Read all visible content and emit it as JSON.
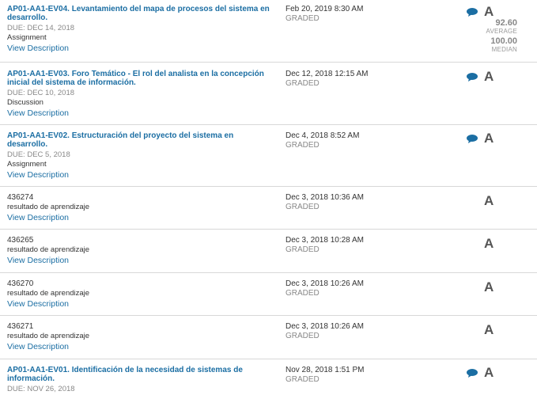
{
  "rows": [
    {
      "title": "AP01-AA1-EV04. Levantamiento del mapa de procesos del sistema en desarrollo.",
      "due": "DUE: DEC 14, 2018",
      "type": "Assignment",
      "view": "View Description",
      "date": "Feb 20, 2019 8:30 AM",
      "status": "GRADED",
      "grade": "A",
      "has_comment": true,
      "average_value": "92.60",
      "average_label": "AVERAGE",
      "median_value": "100.00",
      "median_label": "MEDIAN"
    },
    {
      "title": "AP01-AA1-EV03. Foro Temático - El rol del analista en la concepción inicial del sistema de información.",
      "due": "DUE: DEC 10, 2018",
      "type": "Discussion",
      "view": "View Description",
      "date": "Dec 12, 2018 12:15 AM",
      "status": "GRADED",
      "grade": "A",
      "has_comment": true
    },
    {
      "title": "AP01-AA1-EV02. Estructuración del proyecto del sistema en desarrollo.",
      "due": "DUE: DEC 5, 2018",
      "type": "Assignment",
      "view": "View Description",
      "date": "Dec 4, 2018 8:52 AM",
      "status": "GRADED",
      "grade": "A",
      "has_comment": true
    },
    {
      "id": "436274",
      "type": "resultado de aprendizaje",
      "view": "View Description",
      "date": "Dec 3, 2018 10:36 AM",
      "status": "GRADED",
      "grade": "A",
      "has_comment": false
    },
    {
      "id": "436265",
      "type": "resultado de aprendizaje",
      "view": "View Description",
      "date": "Dec 3, 2018 10:28 AM",
      "status": "GRADED",
      "grade": "A",
      "has_comment": false
    },
    {
      "id": "436270",
      "type": "resultado de aprendizaje",
      "view": "View Description",
      "date": "Dec 3, 2018 10:26 AM",
      "status": "GRADED",
      "grade": "A",
      "has_comment": false
    },
    {
      "id": "436271",
      "type": "resultado de aprendizaje",
      "view": "View Description",
      "date": "Dec 3, 2018 10:26 AM",
      "status": "GRADED",
      "grade": "A",
      "has_comment": false
    },
    {
      "title": "AP01-AA1-EV01. Identificación de la necesidad de sistemas de información.",
      "due": "DUE: NOV 26, 2018",
      "date": "Nov 28, 2018 1:51 PM",
      "status": "GRADED",
      "grade": "A",
      "has_comment": true
    }
  ],
  "colors": {
    "link": "#1b6ea3",
    "grade": "#555555",
    "muted": "#888888",
    "divider": "#d8d8d8"
  },
  "icons": {
    "comment": "speech-bubble-icon"
  }
}
